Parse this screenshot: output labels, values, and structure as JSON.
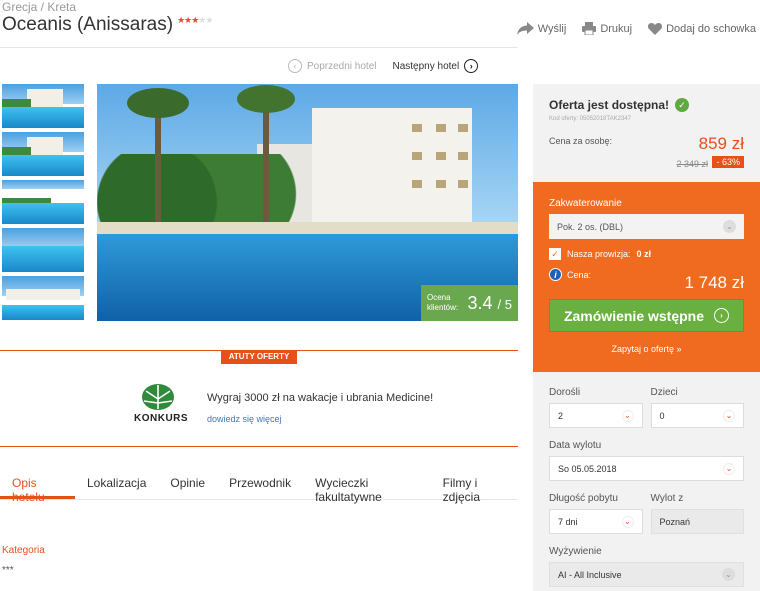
{
  "breadcrumb": {
    "country": "Grecja /",
    "region": "Kreta"
  },
  "hotel": {
    "name": "Oceanis (Anissaras)",
    "stars_filled": "★★★",
    "stars_empty": "★★"
  },
  "actions": {
    "send": "Wyślij",
    "print": "Drukuj",
    "save": "Dodaj do schowka"
  },
  "hotel_nav": {
    "prev": "Poprzedni hotel",
    "next": "Następny hotel"
  },
  "gallery": {
    "rating_label_1": "Ocena",
    "rating_label_2": "klientów:",
    "rating_value": "3.4",
    "rating_max": "/ 5"
  },
  "features": {
    "badge": "ATUTY OFERTY",
    "konkurs_logo": "KONKURS",
    "promo_title": "Wygraj 3000 zł na wakacje i ubrania Medicine!",
    "promo_link": "dowiedz się więcej"
  },
  "tabs": [
    "Opis hotelu",
    "Lokalizacja",
    "Opinie",
    "Przewodnik",
    "Wycieczki fakultatywne",
    "Filmy i zdjęcia"
  ],
  "section": {
    "label": "Kategoria",
    "value": "***"
  },
  "offer": {
    "title": "Oferta jest dostępna!",
    "code": "Kod oferty: 05052018TAK2347",
    "per_person_label": "Cena za osobę:",
    "price": "859 zł",
    "old_price": "2 349 zł",
    "discount": "- 63%"
  },
  "booking": {
    "room_label": "Zakwaterowanie",
    "room_value": "Pok. 2 os. (DBL)",
    "commission_label": "Nasza prowizja:",
    "commission_value": "0 zł",
    "price_label": "Cena:",
    "total": "1 748 zł",
    "order_button": "Zamówienie wstępne",
    "ask_link": "Zapytaj o ofertę »"
  },
  "form": {
    "adults_label": "Dorośli",
    "adults_value": "2",
    "children_label": "Dzieci",
    "children_value": "0",
    "departure_label": "Data wylotu",
    "departure_value": "So 05.05.2018",
    "length_label": "Długość pobytu",
    "length_value": "7 dni",
    "from_label": "Wylot z",
    "from_value": "Poznań",
    "board_label": "Wyżywienie",
    "board_value": "AI - All Inclusive"
  },
  "colors": {
    "accent": "#e8501a",
    "panel_orange": "#f06a1f",
    "button_green": "#69b040",
    "rating_green": "#6aa84f"
  }
}
